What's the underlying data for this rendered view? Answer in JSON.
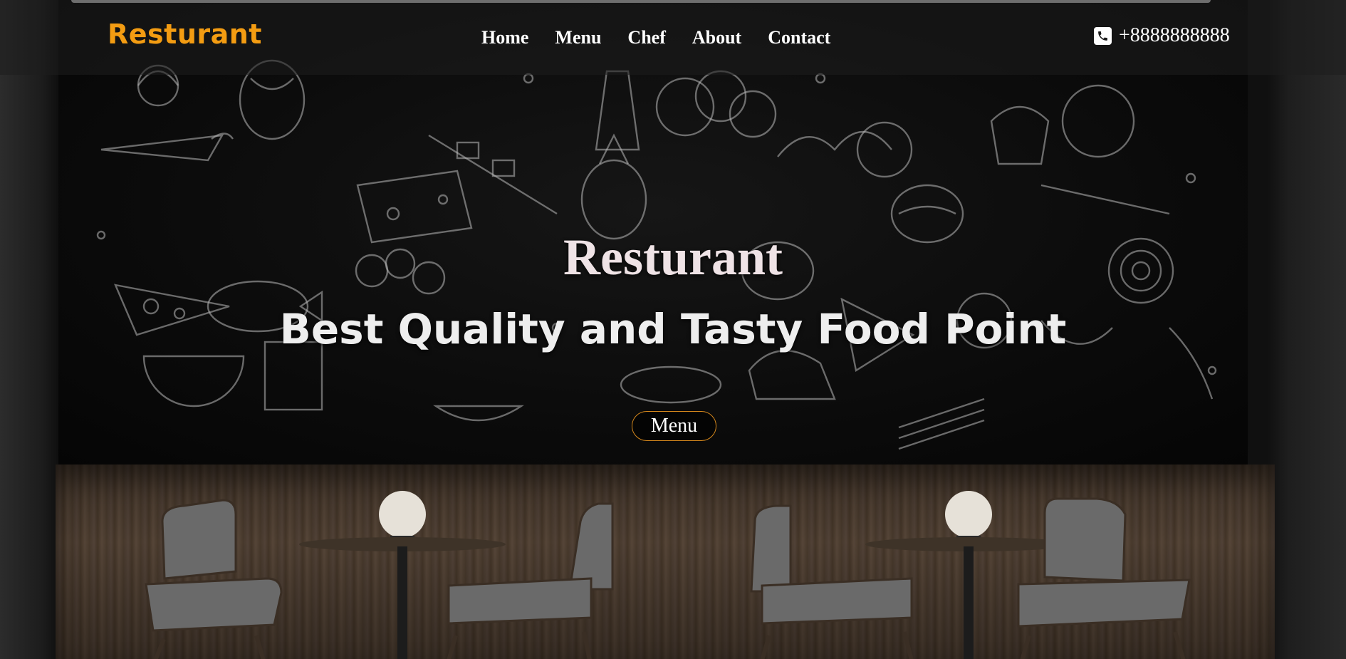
{
  "brand": {
    "logo_text": "Resturant",
    "accent_color": "#f39c12"
  },
  "nav": {
    "items": [
      {
        "label": "Home"
      },
      {
        "label": "Menu"
      },
      {
        "label": "Chef"
      },
      {
        "label": "About"
      },
      {
        "label": "Contact"
      }
    ]
  },
  "contact": {
    "phone_icon": "phone-icon",
    "phone": "+8888888888"
  },
  "hero": {
    "title": "Resturant",
    "subtitle": "Best Quality and Tasty Food Point",
    "cta_label": "Menu",
    "cta_border_color": "#d4871c"
  }
}
